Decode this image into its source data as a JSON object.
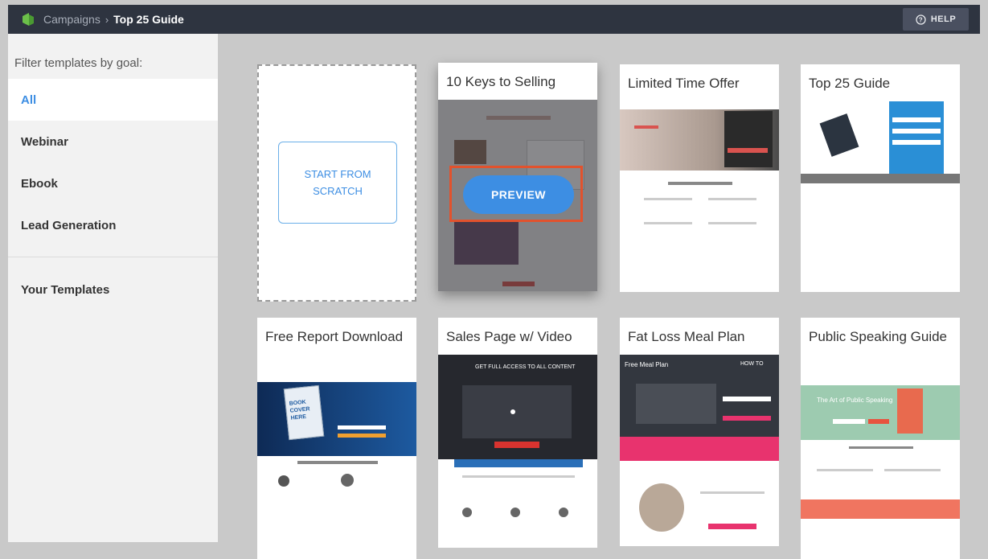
{
  "header": {
    "breadcrumb_parent": "Campaigns",
    "breadcrumb_sep": "›",
    "breadcrumb_current": "Top 25 Guide",
    "help_label": "HELP"
  },
  "sidebar": {
    "title": "Filter templates by goal:",
    "items": [
      {
        "label": "All"
      },
      {
        "label": "Webinar"
      },
      {
        "label": "Ebook"
      },
      {
        "label": "Lead Generation"
      },
      {
        "label": "Your Templates"
      }
    ]
  },
  "scratch": {
    "label_line1": "START FROM",
    "label_line2": "SCRATCH"
  },
  "preview_label": "PREVIEW",
  "templates": [
    {
      "title": "10 Keys to Selling"
    },
    {
      "title": "Limited Time Offer"
    },
    {
      "title": "Top 25 Guide"
    },
    {
      "title": "Free Report Download"
    },
    {
      "title": "Sales Page w/ Video"
    },
    {
      "title": "Fat Loss Meal Plan"
    },
    {
      "title": "Public Speaking Guide"
    }
  ],
  "thumb_text": {
    "book_cover": "BOOK COVER HERE",
    "get_full_access": "GET FULL ACCESS TO ALL CONTENT",
    "art_of_public_speaking": "The Art of Public Speaking",
    "free_meal_plan": "Free Meal Plan",
    "how_to": "HOW TO"
  },
  "colors": {
    "topbar": "#2e3440",
    "accent": "#3d8ee3",
    "highlight": "#e2522d",
    "sidebar_bg": "#f2f2f2",
    "canvas_bg": "#c9c9c9"
  }
}
